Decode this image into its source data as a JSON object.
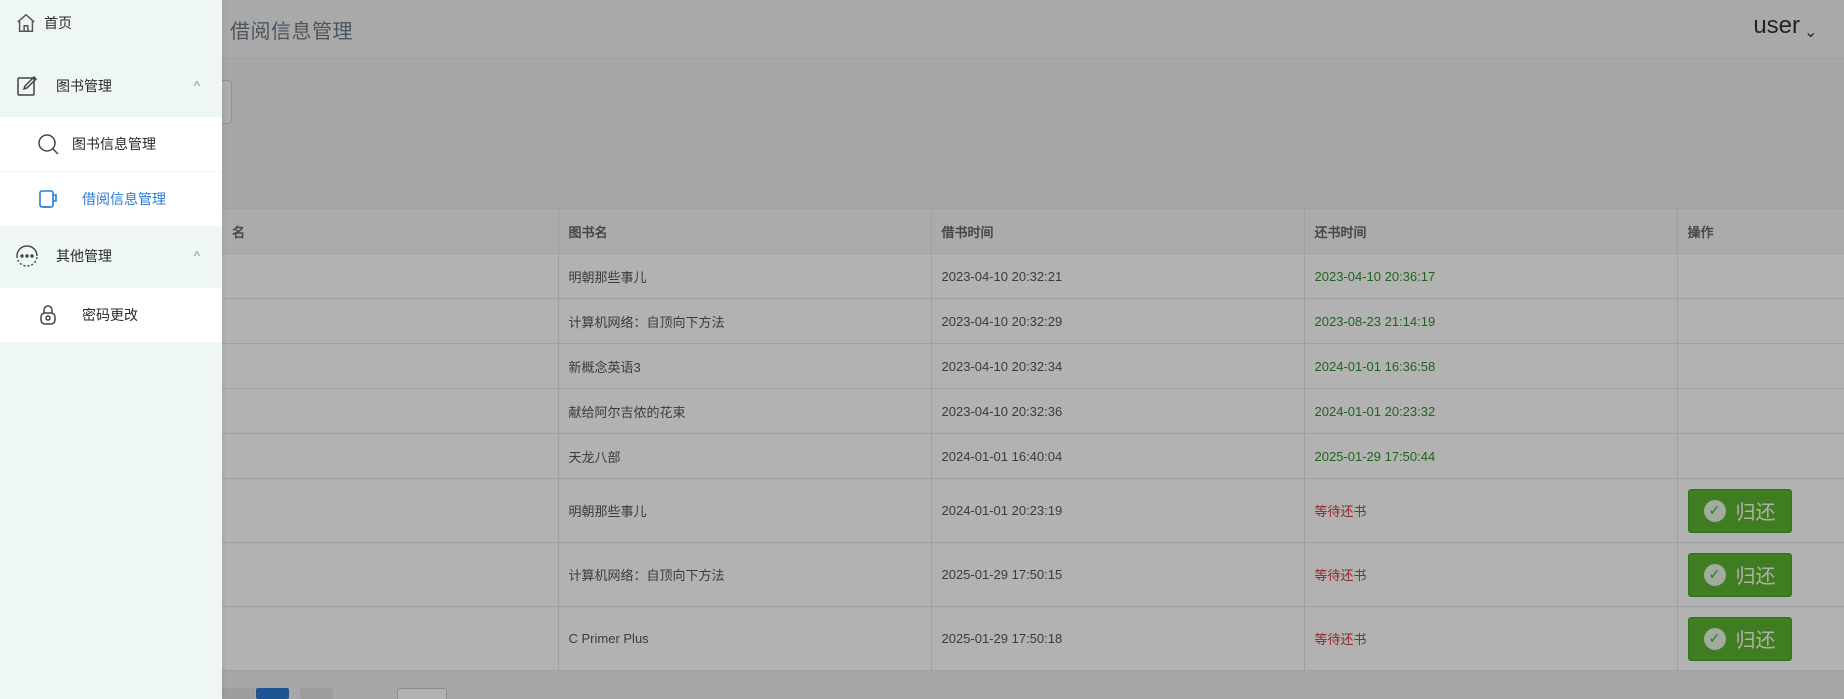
{
  "header": {
    "title": "借阅信息管理",
    "user": "user"
  },
  "sidebar": {
    "home": {
      "label": "首页"
    },
    "groups": [
      {
        "label": "图书管理",
        "items": [
          {
            "label": "图书信息管理"
          },
          {
            "label": "借阅信息管理"
          }
        ]
      },
      {
        "label": "其他管理",
        "items": [
          {
            "label": "密码更改"
          }
        ]
      }
    ]
  },
  "table": {
    "columns": [
      "名",
      "图书名",
      "借书时间",
      "还书时间",
      "操作"
    ],
    "rows": [
      {
        "book": "明朝那些事儿",
        "borrow": "2023-04-10 20:32:21",
        "return": "2023-04-10 20:36:17",
        "status": "returned"
      },
      {
        "book": "计算机网络：自顶向下方法",
        "borrow": "2023-04-10 20:32:29",
        "return": "2023-08-23 21:14:19",
        "status": "returned"
      },
      {
        "book": "新概念英语3",
        "borrow": "2023-04-10 20:32:34",
        "return": "2024-01-01 16:36:58",
        "status": "returned"
      },
      {
        "book": "献给阿尔吉侬的花束",
        "borrow": "2023-04-10 20:32:36",
        "return": "2024-01-01 20:23:32",
        "status": "returned"
      },
      {
        "book": "天龙八部",
        "borrow": "2024-01-01 16:40:04",
        "return": "2025-01-29 17:50:44",
        "status": "returned"
      },
      {
        "book": "明朝那些事儿",
        "borrow": "2024-01-01 20:23:19",
        "return": "等待还书",
        "status": "pending",
        "action": "归还"
      },
      {
        "book": "计算机网络：自顶向下方法",
        "borrow": "2025-01-29 17:50:15",
        "return": "等待还书",
        "status": "pending",
        "action": "归还"
      },
      {
        "book": "C Primer Plus",
        "borrow": "2025-01-29 17:50:18",
        "return": "等待还书",
        "status": "pending",
        "action": "归还"
      }
    ]
  },
  "colors": {
    "accent": "#2b79d6",
    "returned_text": "#2f8f2f",
    "pending_text": "#d33939",
    "return_button": "#5bb232"
  },
  "icons": [
    "home-icon",
    "edit-icon",
    "search-icon",
    "book-return-icon",
    "more-icon",
    "lock-icon",
    "chevron-up-icon",
    "check-circle-icon"
  ]
}
